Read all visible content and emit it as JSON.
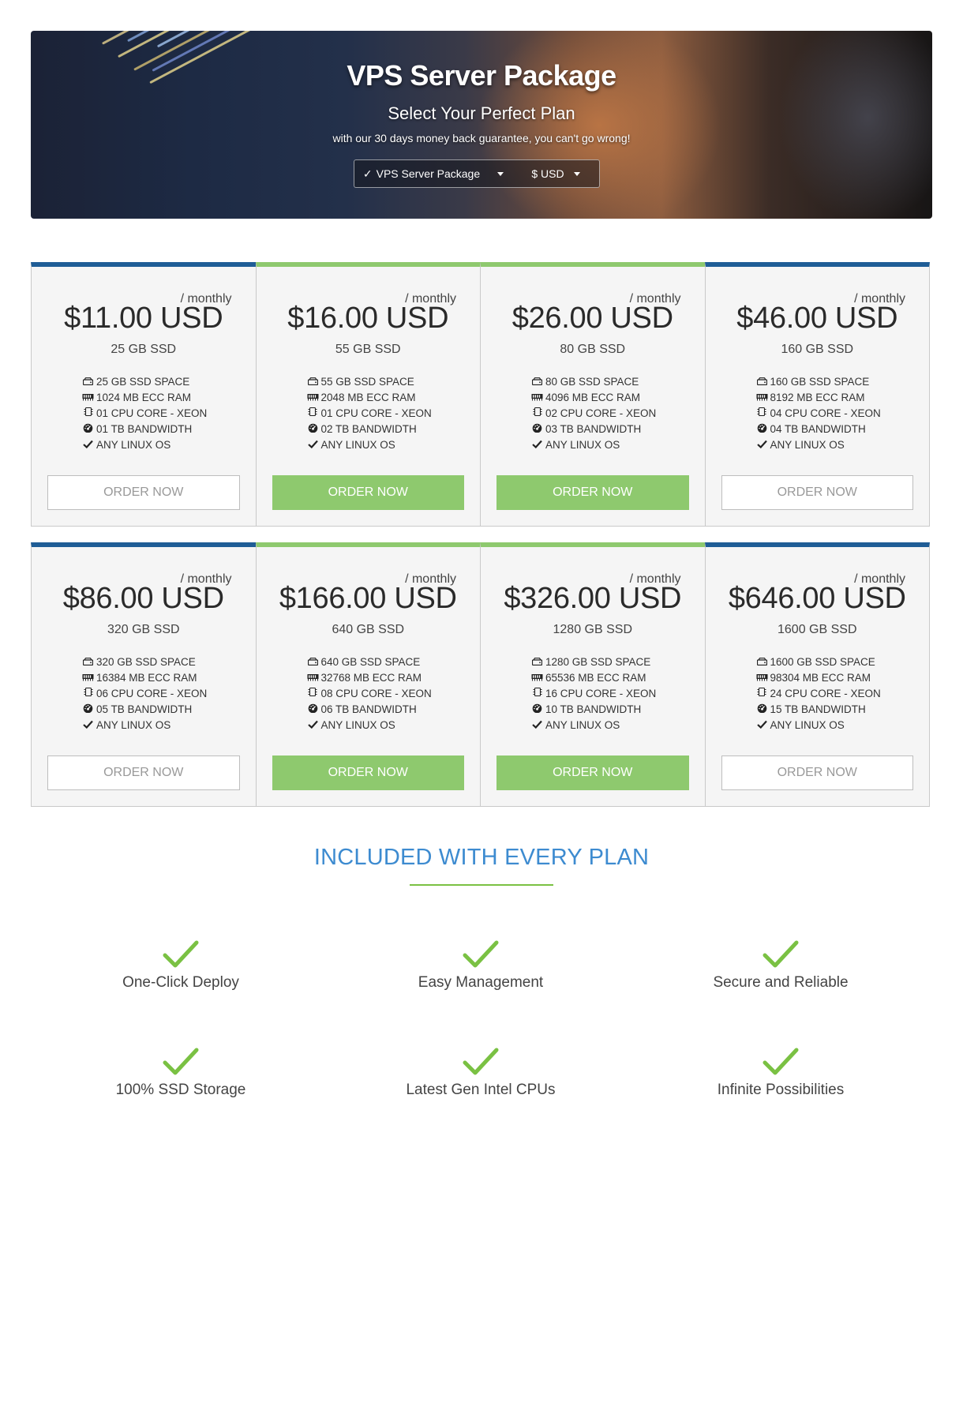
{
  "hero": {
    "title": "VPS Server Package",
    "subtitle": "Select Your Perfect Plan",
    "note": "with our 30 days money back guarantee, you can't go wrong!",
    "package_selector": {
      "check": "✓",
      "label": "VPS Server Package"
    },
    "currency_selector": {
      "label": "$ USD"
    }
  },
  "plans": [
    {
      "price": "$11.00 USD",
      "period": "/ monthly",
      "subtitle": "25 GB SSD",
      "featured": false,
      "features": [
        "25 GB SSD SPACE",
        "1024 MB ECC RAM",
        "01 CPU CORE - XEON",
        "01 TB BANDWIDTH",
        "ANY LINUX OS"
      ],
      "button": "ORDER NOW"
    },
    {
      "price": "$16.00 USD",
      "period": "/ monthly",
      "subtitle": "55 GB SSD",
      "featured": true,
      "features": [
        "55 GB SSD SPACE",
        "2048 MB ECC RAM",
        "01 CPU CORE - XEON",
        "02 TB BANDWIDTH",
        "ANY LINUX OS"
      ],
      "button": "ORDER NOW"
    },
    {
      "price": "$26.00 USD",
      "period": "/ monthly",
      "subtitle": "80 GB SSD",
      "featured": true,
      "features": [
        "80 GB SSD SPACE",
        "4096 MB ECC RAM",
        "02 CPU CORE - XEON",
        "03 TB BANDWIDTH",
        "ANY LINUX OS"
      ],
      "button": "ORDER NOW"
    },
    {
      "price": "$46.00 USD",
      "period": "/ monthly",
      "subtitle": "160 GB SSD",
      "featured": false,
      "features": [
        "160 GB SSD SPACE",
        "8192 MB ECC RAM",
        "04 CPU CORE - XEON",
        "04 TB BANDWIDTH",
        "ANY LINUX OS"
      ],
      "button": "ORDER NOW"
    },
    {
      "price": "$86.00 USD",
      "period": "/ monthly",
      "subtitle": "320 GB SSD",
      "featured": false,
      "features": [
        "320 GB SSD SPACE",
        "16384 MB ECC RAM",
        "06 CPU CORE - XEON",
        "05 TB BANDWIDTH",
        "ANY LINUX OS"
      ],
      "button": "ORDER NOW"
    },
    {
      "price": "$166.00 USD",
      "period": "/ monthly",
      "subtitle": "640 GB SSD",
      "featured": true,
      "features": [
        "640 GB SSD SPACE",
        "32768 MB ECC RAM",
        "08 CPU CORE - XEON",
        "06 TB BANDWIDTH",
        "ANY LINUX OS"
      ],
      "button": "ORDER NOW"
    },
    {
      "price": "$326.00 USD",
      "period": "/ monthly",
      "subtitle": "1280 GB SSD",
      "featured": true,
      "features": [
        "1280 GB SSD SPACE",
        "65536 MB ECC RAM",
        "16 CPU CORE - XEON",
        "10 TB BANDWIDTH",
        "ANY LINUX OS"
      ],
      "button": "ORDER NOW"
    },
    {
      "price": "$646.00 USD",
      "period": "/ monthly",
      "subtitle": "1600 GB SSD",
      "featured": false,
      "features": [
        "1600 GB SSD SPACE",
        "98304 MB ECC RAM",
        "24 CPU CORE - XEON",
        "15 TB BANDWIDTH",
        "ANY LINUX OS"
      ],
      "button": "ORDER NOW"
    }
  ],
  "feature_icons": [
    "hdd-icon",
    "ram-icon",
    "cpu-icon",
    "dashboard-icon",
    "check-icon"
  ],
  "included": {
    "title": "INCLUDED WITH EVERY PLAN",
    "items": [
      "One-Click Deploy",
      "Easy Management",
      "Secure and Reliable",
      "100% SSD Storage",
      "Latest Gen Intel CPUs",
      "Infinite Possibilities"
    ]
  },
  "colors": {
    "accent_blue": "#1f5d96",
    "accent_green": "#8ec96e",
    "check_green": "#7ac143",
    "title_blue": "#3d8bd0"
  }
}
